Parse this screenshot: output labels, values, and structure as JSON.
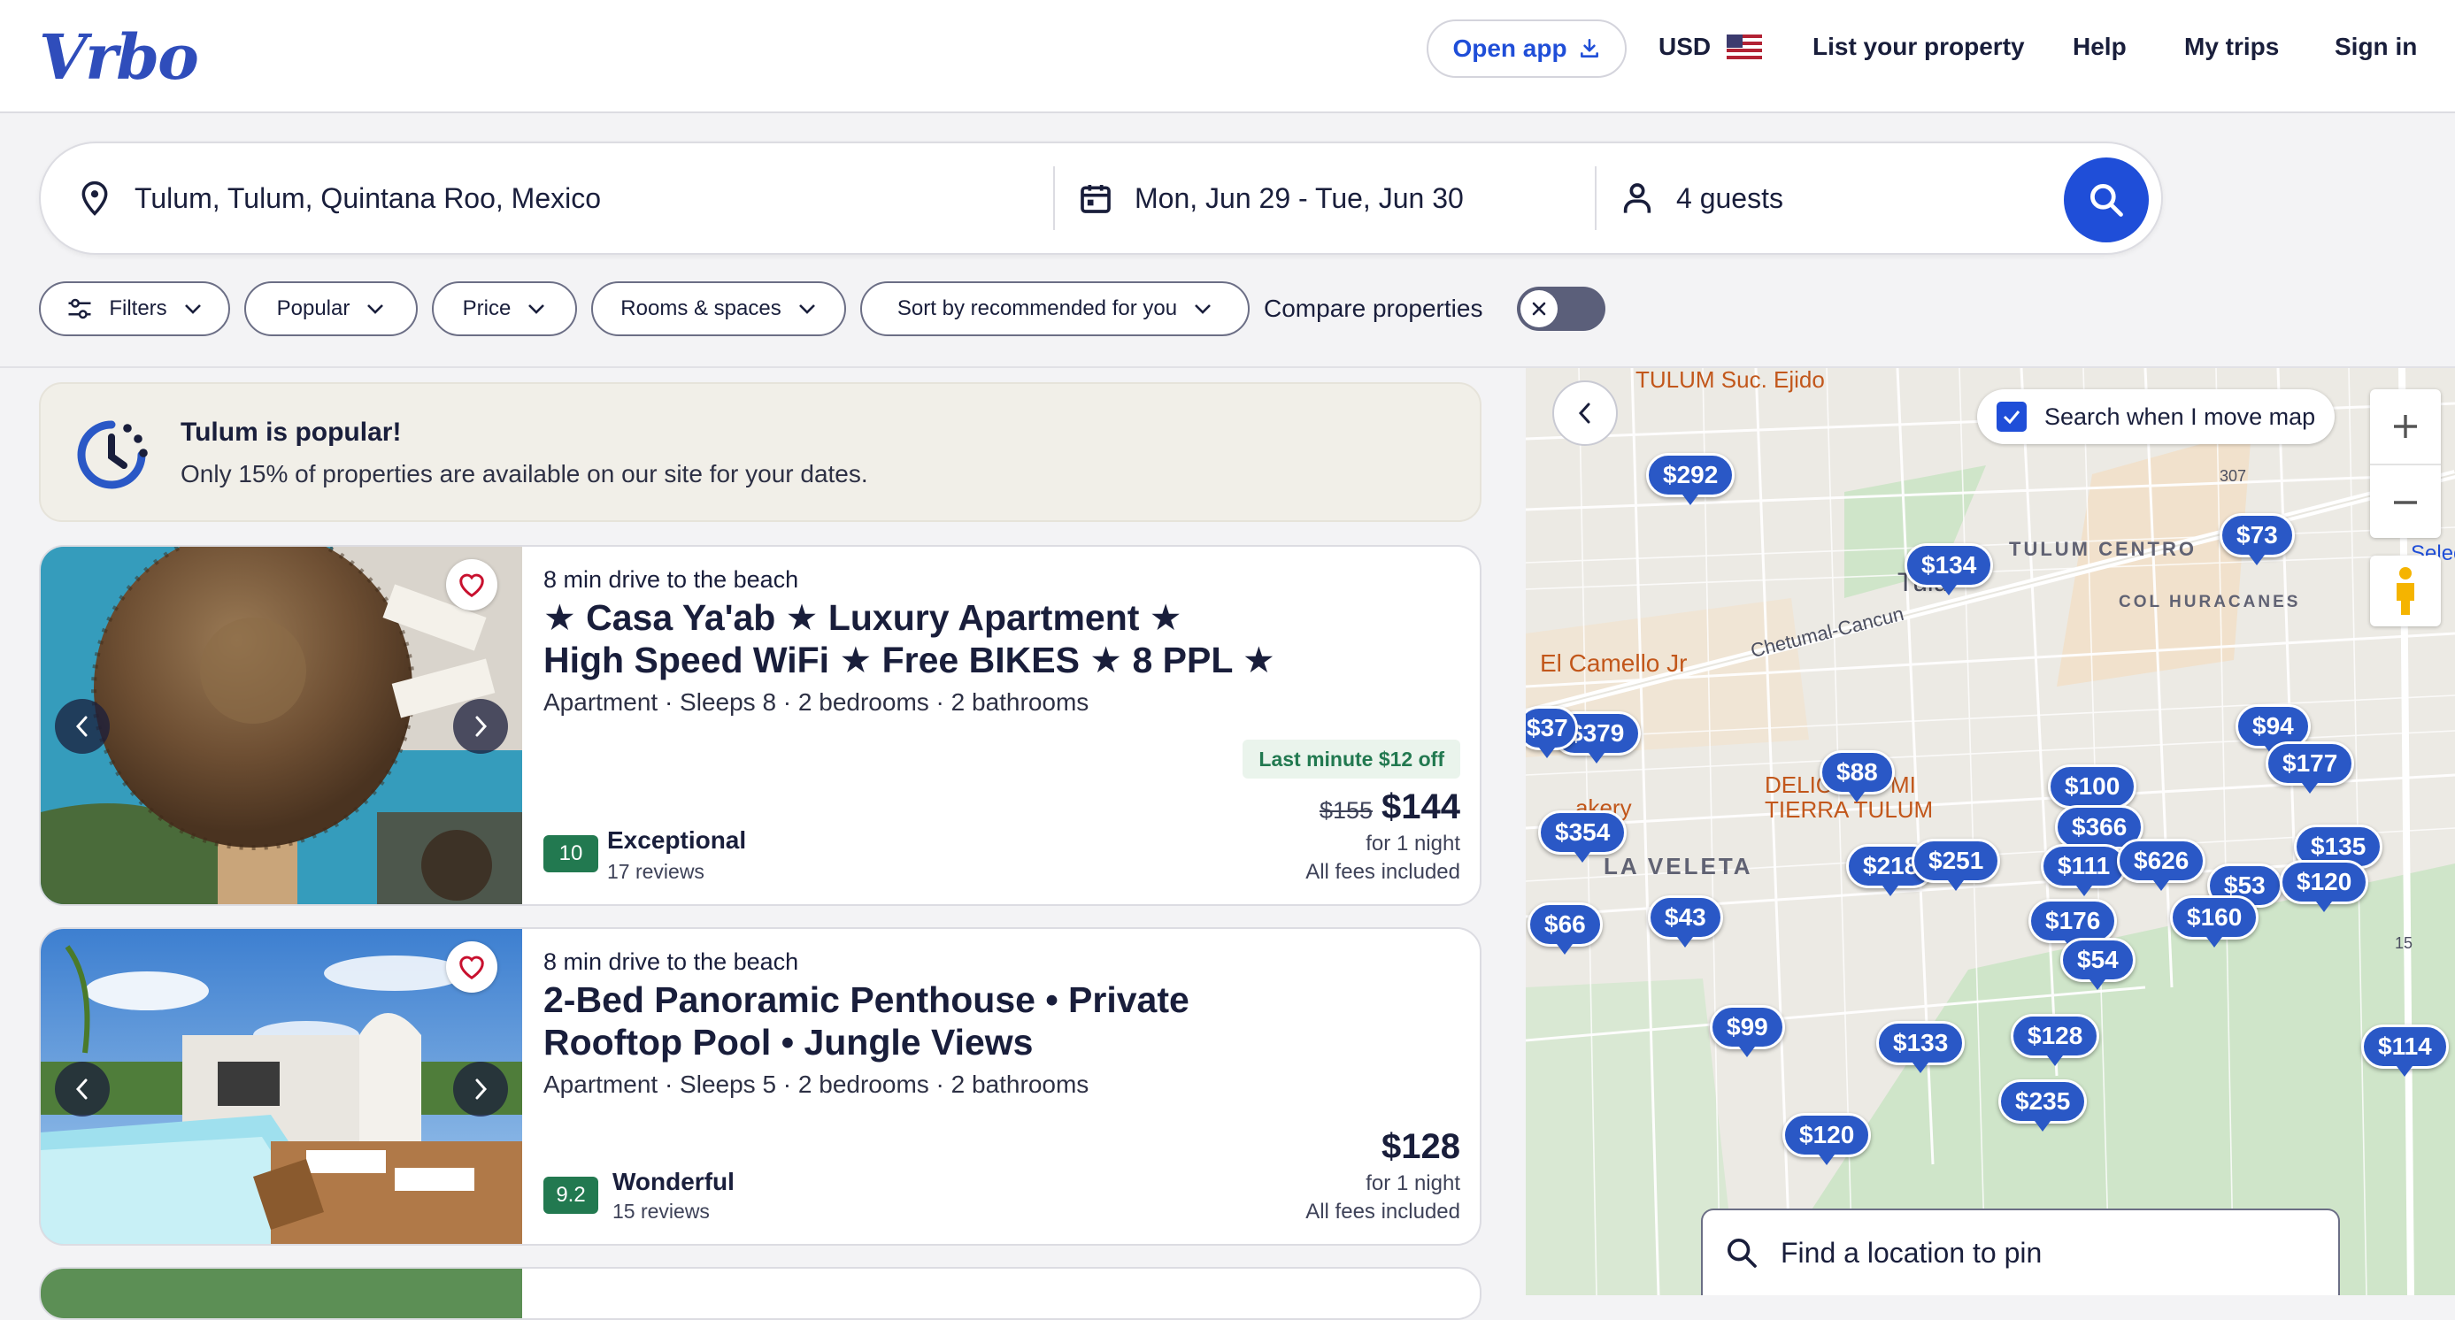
{
  "header": {
    "logo_text": "Vrbo",
    "open_app_label": "Open app",
    "currency_label": "USD",
    "nav_items": [
      "List your property",
      "Help",
      "My trips",
      "Sign in"
    ]
  },
  "search": {
    "destination": "Tulum, Tulum, Quintana Roo, Mexico",
    "dates": "Mon, Jun 29 - Tue, Jun 30",
    "guests": "4 guests"
  },
  "filters": {
    "items": [
      "Filters",
      "Popular",
      "Price",
      "Rooms & spaces",
      "Sort by recommended for you"
    ],
    "compare_label": "Compare properties"
  },
  "banner": {
    "title": "Tulum is popular!",
    "text": "Only 15% of properties are available on our site for your dates."
  },
  "listings": [
    {
      "tagline": "8 min drive to the beach",
      "title_line1": "★ Casa Ya'ab ★ Luxury Apartment ★",
      "title_line2": "High Speed WiFi ★ Free BIKES ★ 8 PPL ★",
      "facts": "Apartment · Sleeps 8 · 2 bedrooms · 2 bathrooms",
      "rating": "10",
      "rating_word": "Exceptional",
      "reviews": "17 reviews",
      "deal": "Last minute $12 off",
      "old_price": "$155",
      "price": "$144",
      "price_note": "for 1 night",
      "fees_note": "All fees included"
    },
    {
      "tagline": "8 min drive to the beach",
      "title_line1": "2-Bed Panoramic Penthouse • Private",
      "title_line2": "Rooftop Pool • Jungle Views",
      "facts": "Apartment · Sleeps 5 · 2 bedrooms · 2 bathrooms",
      "rating": "9.2",
      "rating_word": "Wonderful",
      "reviews": "15 reviews",
      "price": "$128",
      "price_note": "for 1 night",
      "fees_note": "All fees included"
    }
  ],
  "map": {
    "search_when_move_label": "Search when I move map",
    "search_when_move_checked": true,
    "find_pin_placeholder": "Find a location to pin",
    "labels": [
      "TULUM Suc. Ejido",
      "TULUM CENTRO",
      "COL HURACANES",
      "Tulu",
      "El Camello Jr",
      "Chetumal-Cancun",
      "DELICI",
      "MI",
      "TIERRA TULUM",
      "akery",
      "LA VELETA",
      "Selecto",
      "307",
      "15"
    ],
    "price_pins": [
      "$292",
      "$134",
      "$73",
      "$379",
      "$37",
      "$94",
      "$177",
      "$88",
      "$100",
      "$354",
      "$366",
      "$218",
      "$251",
      "$111",
      "$626",
      "$53",
      "$135",
      "$120",
      "$66",
      "$43",
      "$176",
      "$160",
      "$54",
      "$99",
      "$133",
      "$128",
      "$235",
      "$120",
      "$114"
    ]
  },
  "colors": {
    "brand_blue": "#1f4ed8",
    "pin_blue": "#2a58c6",
    "rating_green": "#227950"
  }
}
